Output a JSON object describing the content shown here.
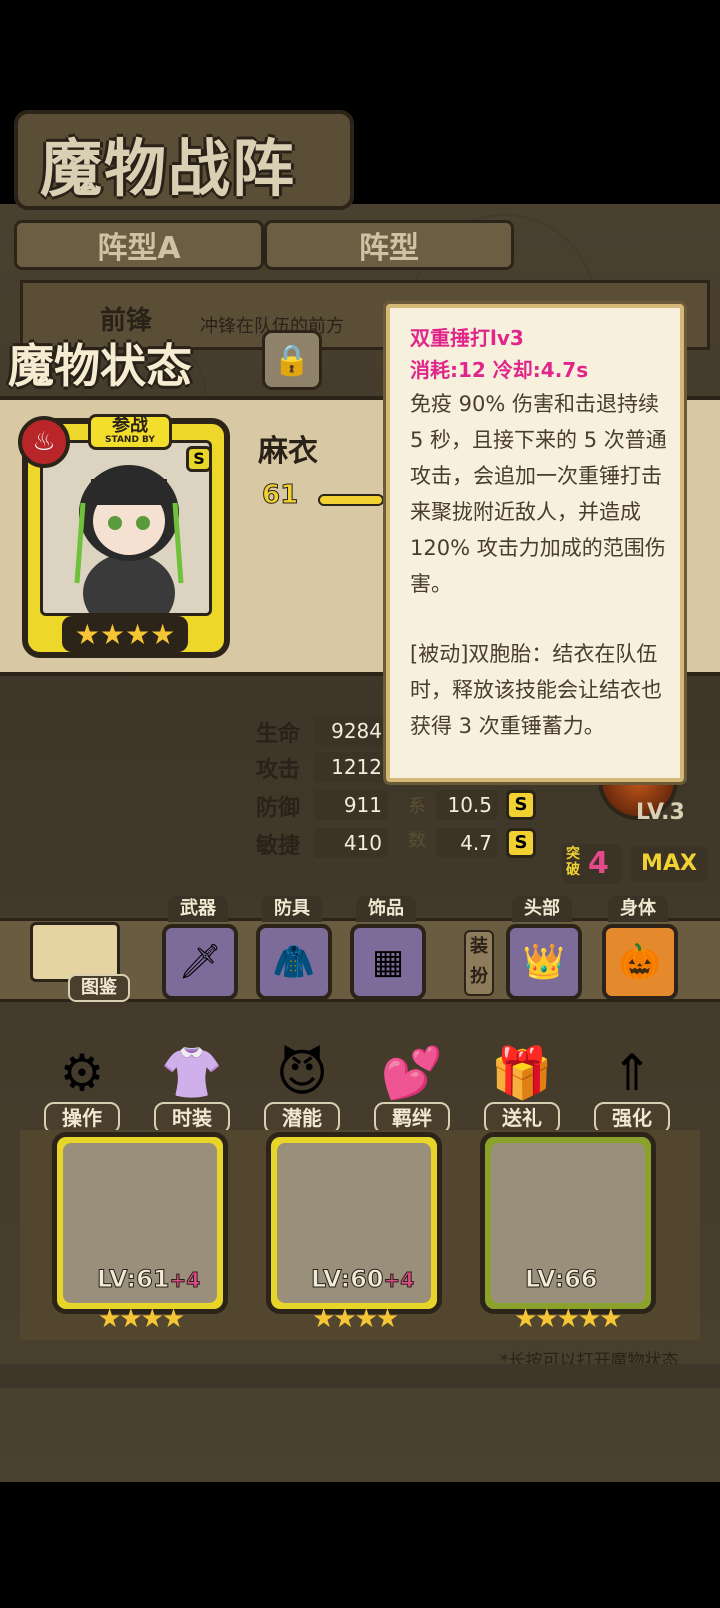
{
  "screen": {
    "title": "魔物战阵",
    "tabs": [
      "阵型A",
      "阵型"
    ],
    "frontline": {
      "title": "前锋",
      "desc": "冲锋在队伍的前方"
    },
    "status_title": "魔物状态"
  },
  "hero": {
    "standby": "参战",
    "standby_sub": "STAND BY",
    "rank": "S",
    "name": "麻衣",
    "level": "61",
    "stars": "★★★★",
    "stats": [
      {
        "label": "生命",
        "value": "9284"
      },
      {
        "label": "攻击",
        "value": "1212"
      },
      {
        "label": "防御",
        "value": "911"
      },
      {
        "label": "敏捷",
        "value": "410"
      }
    ],
    "coeff_labels": [
      "系",
      "数"
    ],
    "coeffs": [
      {
        "value": "10.5",
        "rank": "S"
      },
      {
        "value": "4.7",
        "rank": "S"
      }
    ],
    "skill_level": "LV.3",
    "breakthrough_label": "突破",
    "breakthrough": "4",
    "max_label": "MAX"
  },
  "equipment": {
    "book_label": "图鉴",
    "slots": [
      {
        "label": "武器",
        "icon": "sword-icon"
      },
      {
        "label": "防具",
        "icon": "cloak-icon"
      },
      {
        "label": "饰品",
        "icon": "tablet-icon"
      },
      {
        "label": "头部",
        "icon": "crown-icon"
      },
      {
        "label": "身体",
        "icon": "pumpkin-icon"
      }
    ],
    "dress_tag": "装扮"
  },
  "actions": [
    {
      "label": "操作",
      "icon": "gear-icon"
    },
    {
      "label": "时装",
      "icon": "outfit-icon"
    },
    {
      "label": "潜能",
      "icon": "demon-icon"
    },
    {
      "label": "羁绊",
      "icon": "hearts-icon"
    },
    {
      "label": "送礼",
      "icon": "gift-icon"
    },
    {
      "label": "强化",
      "icon": "upgrade-arrows-icon"
    }
  ],
  "roster": [
    {
      "lv": "LV:61",
      "plus": "+4",
      "stars": "★★★★"
    },
    {
      "lv": "LV:60",
      "plus": "+4",
      "stars": "★★★★"
    },
    {
      "lv": "LV:66",
      "plus": "",
      "stars": "★★★★★"
    }
  ],
  "hint": "*长按可以打开魔物状态",
  "tooltip": {
    "title": "双重捶打lv3",
    "cost": "消耗:12   冷却:4.7s",
    "desc": "免疫 90% 伤害和击退持续 5 秒，且接下来的 5 次普通攻击，会追加一次重锤打击来聚拢附近敌人，并造成 120% 攻击力加成的范围伤害。",
    "passive": "[被动]双胞胎：结衣在队伍时，释放该技能会让结衣也获得 3 次重锤蓄力。"
  },
  "colors": {
    "accent_pink": "#e0268a",
    "gold": "#f1d232",
    "frame_dark": "#2c2418"
  }
}
